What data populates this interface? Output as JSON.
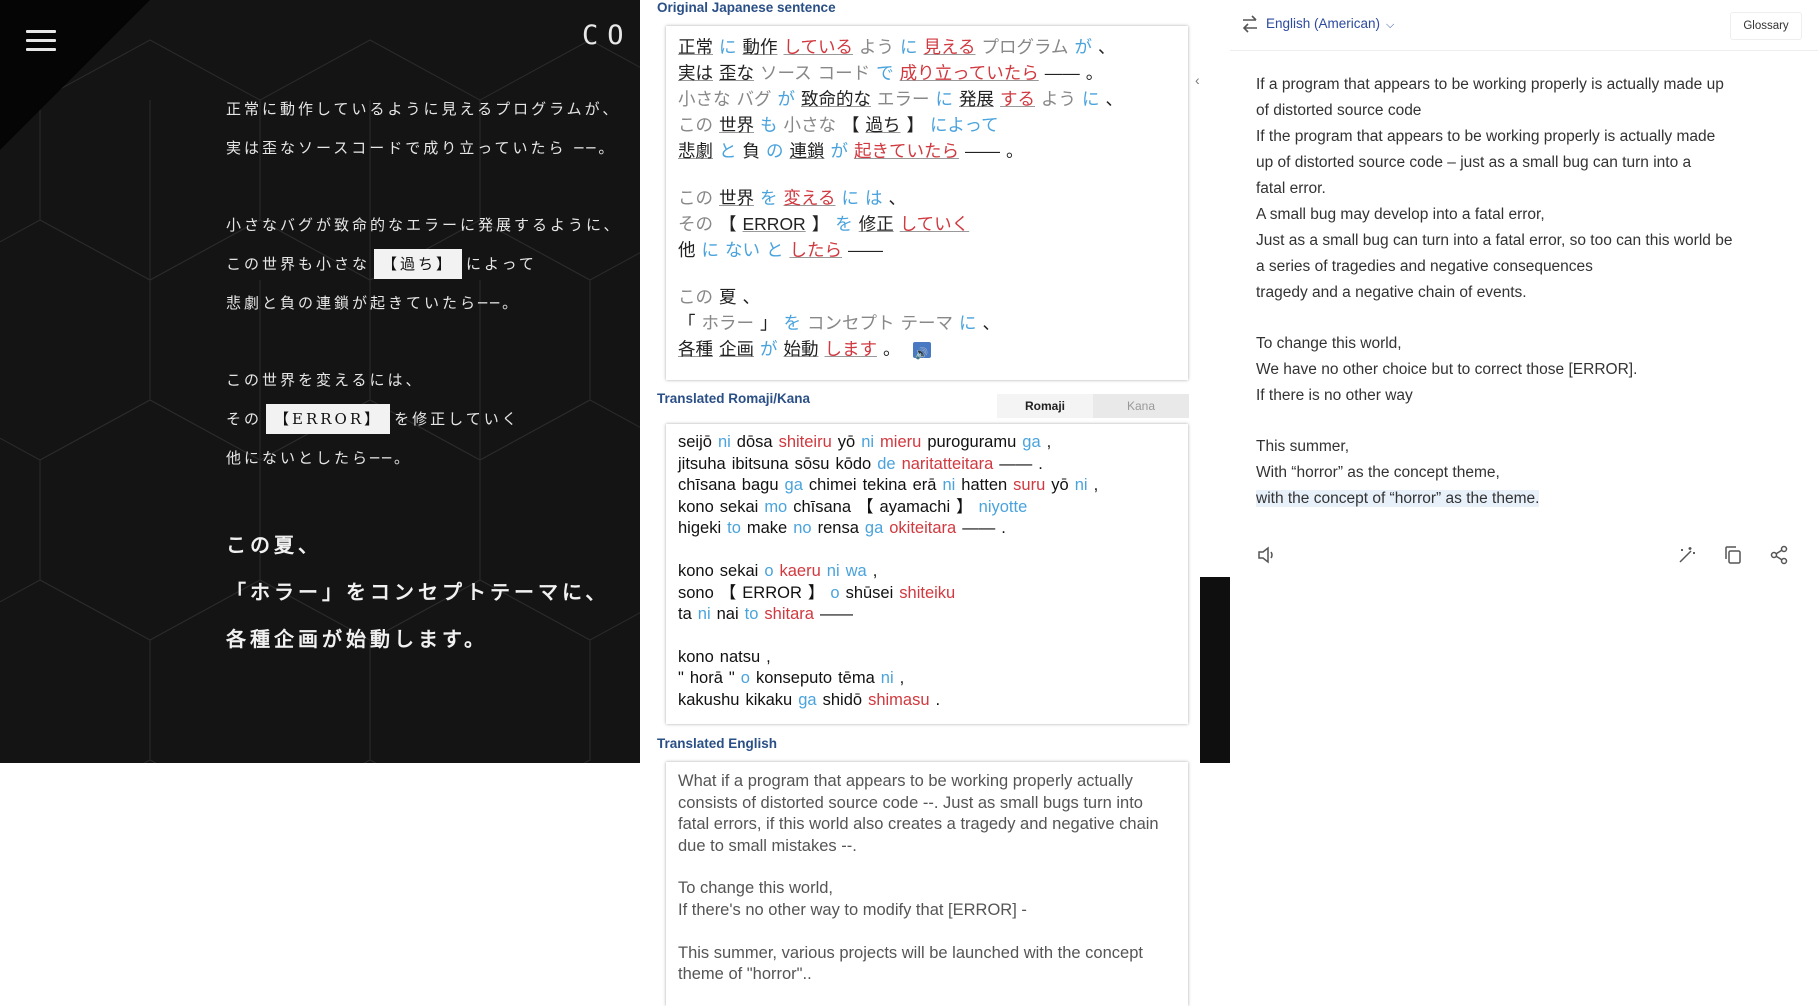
{
  "left_panel": {
    "logo_text": "CO",
    "para1": [
      "正常に動作しているように見えるプログラムが、",
      "実は歪なソースコードで成り立っていたら ──。"
    ],
    "para2": {
      "line1": "小さなバグが致命的なエラーに発展するように、",
      "line2_pre": "この世界も小さな",
      "line2_box": "【過ち】",
      "line2_post": "によって",
      "line3": "悲劇と負の連鎖が起きていたら──。"
    },
    "para3": {
      "line1": "この世界を変えるには、",
      "line2_pre": "その",
      "line2_box": "【ERROR】",
      "line2_post": "を修正していく",
      "line3": "他にないとしたら──。"
    },
    "para4": [
      "この夏、",
      "「ホラー」をコンセプトテーマに、",
      "各種企画が始動します。"
    ]
  },
  "middle_panel": {
    "original_label": "Original Japanese sentence",
    "romaji_label": "Translated Romaji/Kana",
    "english_label": "Translated English",
    "tabs": [
      "Romaji",
      "Kana"
    ],
    "japanese_rows": [
      [
        [
          "正常",
          "n"
        ],
        [
          "に",
          "b"
        ],
        [
          "動作",
          "n"
        ],
        [
          "している",
          "r"
        ],
        [
          "よう",
          "g"
        ],
        [
          "に",
          "b"
        ],
        [
          "見える",
          "r"
        ],
        [
          "プログラム",
          "g"
        ],
        [
          "が",
          "b"
        ],
        [
          "、",
          "n"
        ]
      ],
      [
        [
          "実は",
          "n"
        ],
        [
          "歪な",
          "n"
        ],
        [
          "ソース",
          "g"
        ],
        [
          "コード",
          "g"
        ],
        [
          "で",
          "b"
        ],
        [
          "成り立っていたら",
          "r"
        ],
        [
          "――",
          "n"
        ],
        [
          "。",
          "n"
        ]
      ],
      [
        [
          "小さな",
          "g"
        ],
        [
          "バグ",
          "g"
        ],
        [
          "が",
          "b"
        ],
        [
          "致命的な",
          "n"
        ],
        [
          "エラー",
          "g"
        ],
        [
          "に",
          "b"
        ],
        [
          "発展",
          "n"
        ],
        [
          "する",
          "r"
        ],
        [
          "よう",
          "g"
        ],
        [
          "に",
          "b"
        ],
        [
          "、",
          "n"
        ]
      ],
      [
        [
          "この",
          "g"
        ],
        [
          "世界",
          "n"
        ],
        [
          "も",
          "b"
        ],
        [
          "小さな",
          "g"
        ],
        [
          "【",
          "n"
        ],
        [
          "過ち",
          "n"
        ],
        [
          "】",
          "n"
        ],
        [
          "によって",
          "b"
        ]
      ],
      [
        [
          "悲劇",
          "n"
        ],
        [
          "と",
          "b"
        ],
        [
          "負",
          "n"
        ],
        [
          "の",
          "b"
        ],
        [
          "連鎖",
          "n"
        ],
        [
          "が",
          "b"
        ],
        [
          "起きていたら",
          "r"
        ],
        [
          "――",
          "n"
        ],
        [
          "。",
          "n"
        ]
      ],
      null,
      [
        [
          "この",
          "g"
        ],
        [
          "世界",
          "n"
        ],
        [
          "を",
          "b"
        ],
        [
          "変える",
          "r"
        ],
        [
          "に",
          "b"
        ],
        [
          "は",
          "b"
        ],
        [
          "、",
          "n"
        ]
      ],
      [
        [
          "その",
          "g"
        ],
        [
          "【",
          "n"
        ],
        [
          "ERROR",
          "n"
        ],
        [
          "】",
          "n"
        ],
        [
          "を",
          "b"
        ],
        [
          "修正",
          "n"
        ],
        [
          "していく",
          "r"
        ]
      ],
      [
        [
          "他",
          "n"
        ],
        [
          "に",
          "b"
        ],
        [
          "ない",
          "b"
        ],
        [
          "と",
          "b"
        ],
        [
          "したら",
          "r"
        ],
        [
          "――",
          "n"
        ]
      ],
      null,
      [
        [
          "この",
          "g"
        ],
        [
          "夏",
          "n"
        ],
        [
          "、",
          "n"
        ]
      ],
      [
        [
          "「",
          "n"
        ],
        [
          "ホラー",
          "g"
        ],
        [
          "」",
          "n"
        ],
        [
          "を",
          "b"
        ],
        [
          "コンセプト",
          "g"
        ],
        [
          "テーマ",
          "g"
        ],
        [
          "に",
          "b"
        ],
        [
          "、",
          "n"
        ]
      ],
      [
        [
          "各種",
          "n"
        ],
        [
          "企画",
          "n"
        ],
        [
          "が",
          "b"
        ],
        [
          "始動",
          "n"
        ],
        [
          "します",
          "r"
        ],
        [
          "。",
          "n"
        ]
      ]
    ],
    "romaji_rows": [
      [
        [
          "seijō",
          "n"
        ],
        [
          "ni",
          "b"
        ],
        [
          "dōsa",
          "n"
        ],
        [
          "shiteiru",
          "r"
        ],
        [
          "yō",
          "n"
        ],
        [
          "ni",
          "b"
        ],
        [
          "mieru",
          "r"
        ],
        [
          "puroguramu",
          "n"
        ],
        [
          "ga",
          "b"
        ],
        [
          ",",
          "n"
        ]
      ],
      [
        [
          "jitsuha",
          "n"
        ],
        [
          "ibitsuna",
          "n"
        ],
        [
          "sōsu",
          "n"
        ],
        [
          "kōdo",
          "n"
        ],
        [
          "de",
          "b"
        ],
        [
          "naritatteitara",
          "r"
        ],
        [
          "——",
          "n"
        ],
        [
          ".",
          "n"
        ]
      ],
      [
        [
          "chīsana",
          "n"
        ],
        [
          "bagu",
          "n"
        ],
        [
          "ga",
          "b"
        ],
        [
          "chimei",
          "n"
        ],
        [
          "tekina",
          "n"
        ],
        [
          "erā",
          "n"
        ],
        [
          "ni",
          "b"
        ],
        [
          "hatten",
          "n"
        ],
        [
          "suru",
          "r"
        ],
        [
          "yō",
          "n"
        ],
        [
          "ni",
          "b"
        ],
        [
          ",",
          "n"
        ]
      ],
      [
        [
          "kono",
          "n"
        ],
        [
          "sekai",
          "n"
        ],
        [
          "mo",
          "b"
        ],
        [
          "chīsana",
          "n"
        ],
        [
          "【",
          "n"
        ],
        [
          "ayamachi",
          "n"
        ],
        [
          "】",
          "n"
        ],
        [
          "niyotte",
          "b"
        ]
      ],
      [
        [
          "higeki",
          "n"
        ],
        [
          "to",
          "b"
        ],
        [
          "make",
          "n"
        ],
        [
          "no",
          "b"
        ],
        [
          "rensa",
          "n"
        ],
        [
          "ga",
          "b"
        ],
        [
          "okiteitara",
          "r"
        ],
        [
          "——",
          "n"
        ],
        [
          ".",
          "n"
        ]
      ],
      null,
      [
        [
          "kono",
          "n"
        ],
        [
          "sekai",
          "n"
        ],
        [
          "o",
          "b"
        ],
        [
          "kaeru",
          "r"
        ],
        [
          "ni",
          "b"
        ],
        [
          "wa",
          "b"
        ],
        [
          ",",
          "n"
        ]
      ],
      [
        [
          "sono",
          "n"
        ],
        [
          "【",
          "n"
        ],
        [
          "ERROR",
          "n"
        ],
        [
          "】",
          "n"
        ],
        [
          "o",
          "b"
        ],
        [
          "shūsei",
          "n"
        ],
        [
          "shiteiku",
          "r"
        ]
      ],
      [
        [
          "ta",
          "n"
        ],
        [
          "ni",
          "b"
        ],
        [
          "nai",
          "n"
        ],
        [
          "to",
          "b"
        ],
        [
          "shitara",
          "r"
        ],
        [
          "——",
          "n"
        ]
      ],
      null,
      [
        [
          "kono",
          "n"
        ],
        [
          "natsu",
          "n"
        ],
        [
          ",",
          "n"
        ]
      ],
      [
        [
          "\"",
          "n"
        ],
        [
          "horā",
          "n"
        ],
        [
          "\"",
          "n"
        ],
        [
          "o",
          "b"
        ],
        [
          "konseputo",
          "n"
        ],
        [
          "tēma",
          "n"
        ],
        [
          "ni",
          "b"
        ],
        [
          ",",
          "n"
        ]
      ],
      [
        [
          "kakushu",
          "n"
        ],
        [
          "kikaku",
          "n"
        ],
        [
          "ga",
          "b"
        ],
        [
          "shidō",
          "n"
        ],
        [
          "shimasu",
          "r"
        ],
        [
          ".",
          "n"
        ]
      ]
    ],
    "english_paragraphs": [
      "What if a program that appears to be working properly actually consists of distorted source code --. Just as small bugs turn into fatal errors, if this world also creates a tragedy and negative chain due to small mistakes --.",
      "To change this world,\nIf there's no other way to modify that [ERROR] -",
      "This summer, various projects will be launched with the concept theme of \"horror\".."
    ]
  },
  "right_panel": {
    "language": "English (American)",
    "glossary_label": "Glossary",
    "output_lines": [
      {
        "t": "If a program that appears to be working properly is actually made up"
      },
      {
        "t": "of distorted source code"
      },
      {
        "t": "If the program that appears to be working properly is actually made"
      },
      {
        "t": "up of distorted source code – just as a small bug can turn into a"
      },
      {
        "t": "fatal error."
      },
      {
        "t": "A small bug may develop into a fatal error,"
      },
      {
        "t": "Just as a small bug can turn into a fatal error, so too can this world be"
      },
      {
        "t": "a series of tragedies and negative consequences"
      },
      {
        "t": "tragedy and a negative chain of events."
      },
      {
        "gap": true
      },
      {
        "t": "To change this world,"
      },
      {
        "t": "We have no other choice but to correct those [ERROR]."
      },
      {
        "t": "If there is no other way"
      },
      {
        "gap": true
      },
      {
        "t": "This summer,"
      },
      {
        "t": "With “horror” as the concept theme,"
      },
      {
        "t": "with the concept of “horror” as the theme.",
        "hl": true
      }
    ],
    "icons": [
      "speaker-icon",
      "magic-wand-icon",
      "copy-icon",
      "share-icon"
    ]
  },
  "colors": {
    "particle_blue": "#4aa3dc",
    "verb_red": "#d0393f",
    "kana_gray": "#888888",
    "label_navy": "#2a4f86",
    "link_blue": "#2c4aa0"
  }
}
